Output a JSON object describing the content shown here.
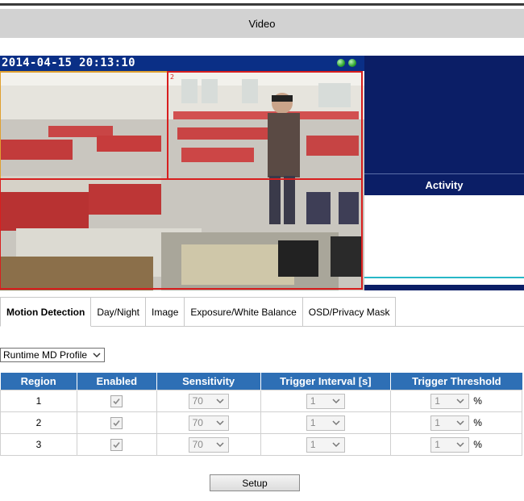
{
  "header": {
    "title": "Video"
  },
  "video": {
    "timestamp": "2014-04-15 20:13:10"
  },
  "activity": {
    "title": "Activity"
  },
  "tabs": [
    {
      "label": "Motion Detection",
      "active": true
    },
    {
      "label": "Day/Night",
      "active": false
    },
    {
      "label": "Image",
      "active": false
    },
    {
      "label": "Exposure/White Balance",
      "active": false
    },
    {
      "label": "OSD/Privacy Mask",
      "active": false
    }
  ],
  "profile_select": {
    "value": "Runtime MD Profile"
  },
  "table": {
    "headers": [
      "Region",
      "Enabled",
      "Sensitivity",
      "Trigger Interval [s]",
      "Trigger Threshold"
    ],
    "rows": [
      {
        "region": "1",
        "enabled": true,
        "sensitivity": "70",
        "interval": "1",
        "threshold": "1",
        "unit": "%"
      },
      {
        "region": "2",
        "enabled": true,
        "sensitivity": "70",
        "interval": "1",
        "threshold": "1",
        "unit": "%"
      },
      {
        "region": "3",
        "enabled": true,
        "sensitivity": "70",
        "interval": "1",
        "threshold": "1",
        "unit": "%"
      }
    ]
  },
  "buttons": {
    "setup": "Setup"
  },
  "colors": {
    "header_bg": "#d2d2d2",
    "table_header_bg": "#2e6fb5",
    "activity_bg": "#0b1e66",
    "region_1": "#e0a030",
    "region_2": "#d81e1e",
    "region_3": "#d81e1e",
    "activity_line": "#27b7c7"
  }
}
